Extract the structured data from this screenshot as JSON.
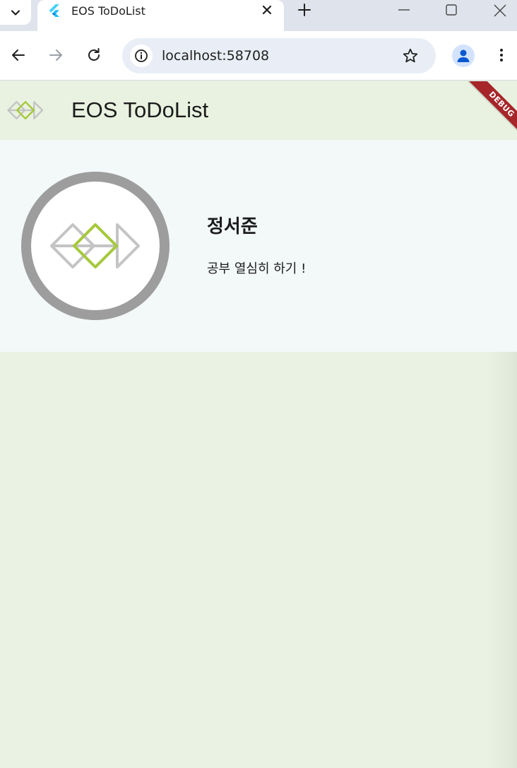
{
  "browser": {
    "tab": {
      "title": "EOS ToDoList"
    },
    "address": {
      "url": "localhost:58708"
    }
  },
  "app": {
    "title": "EOS ToDoList",
    "debug_banner": "DEBUG",
    "profile": {
      "name": "정서준",
      "motto": "공부 열심히 하기 !"
    }
  },
  "colors": {
    "app_background": "#eaf2e3",
    "card_background": "#f3f8f8",
    "logo_gray": "#c4c4c4",
    "logo_green": "#a5c93a",
    "avatar_ring": "#9d9d9d",
    "debug_ribbon": "#a6262a"
  },
  "icons": {
    "tab_search": "chevron-down-icon",
    "tab_favicon": "flutter-icon",
    "tab_close": "close-icon",
    "new_tab": "plus-icon",
    "back": "arrow-left-icon",
    "forward": "arrow-right-icon",
    "reload": "reload-icon",
    "site_info": "info-icon",
    "bookmark": "star-icon",
    "profile": "person-icon",
    "menu": "kebab-menu-icon"
  }
}
